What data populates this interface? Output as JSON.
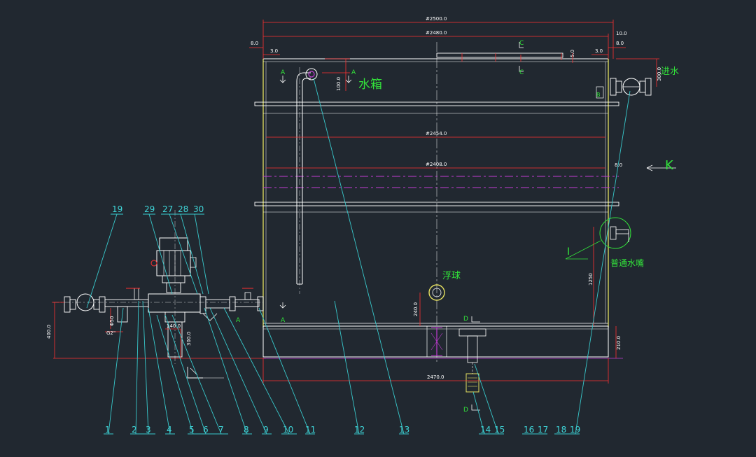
{
  "colors": {
    "background": "#212830",
    "outline": "#ffffff",
    "tank_side": "#e5e060",
    "dimension": "#ff3030",
    "leader": "#38c9cc",
    "label": "#32e23a",
    "water_level": "#c23cd4"
  },
  "labels": {
    "tank": "水箱",
    "inlet": "进水",
    "float_ball": "浮球",
    "faucet": "普通水嘴",
    "view_k": "K",
    "detail_i": "I",
    "sec_a_left": "A",
    "sec_a_right": "A",
    "sec_a_low_left": "A",
    "sec_a_low_right": "A",
    "sec_c_top": "C",
    "sec_c_bottom": "C",
    "sec_d_top": "D",
    "sec_d_bottom": "D",
    "sec_b": "B"
  },
  "dimensions": {
    "d2500": "#2500.0",
    "d2480": "#2480.0",
    "d2454": "#2454.0",
    "d2408": "#2408.0",
    "d2470": "2470.0",
    "d10": "10.0",
    "d8_left": "8.0",
    "d8_right": "8.0",
    "d8_mid": "8.0",
    "d3_left": "3.0",
    "d3_right": "3.0",
    "d5": "5.0",
    "d100": "100.0",
    "d300": "300.0",
    "d1250": "1250",
    "d240": "240.0",
    "d210": "210.0",
    "d140": "140.0",
    "d300b": "300.0",
    "d400": "400.0",
    "phi50": "Φ50",
    "g2": "G2\""
  },
  "top_callouts": [
    "19",
    "29",
    "27",
    "28",
    "30"
  ],
  "bottom_callouts": [
    "1",
    "2",
    "3",
    "4",
    "5",
    "6",
    "7",
    "8",
    "9",
    "10",
    "11",
    "12",
    "13",
    "14",
    "15",
    "16",
    "17",
    "18",
    "19"
  ]
}
